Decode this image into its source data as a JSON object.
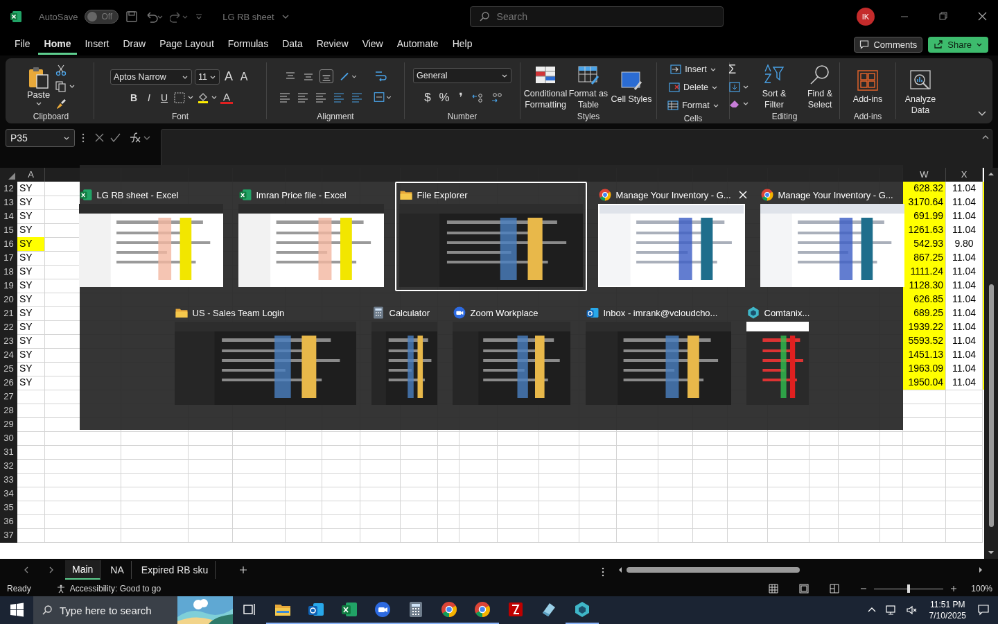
{
  "titlebar": {
    "autosave_label": "AutoSave",
    "autosave": {
      "label": "Off",
      "on": false
    },
    "doc_title": "LG RB sheet",
    "search_placeholder": "Search",
    "avatar": "IK"
  },
  "menu_tabs": [
    {
      "label": "File",
      "selected": false
    },
    {
      "label": "Home",
      "selected": true
    },
    {
      "label": "Insert",
      "selected": false
    },
    {
      "label": "Draw",
      "selected": false
    },
    {
      "label": "Page Layout",
      "selected": false
    },
    {
      "label": "Formulas",
      "selected": false
    },
    {
      "label": "Data",
      "selected": false
    },
    {
      "label": "Review",
      "selected": false
    },
    {
      "label": "View",
      "selected": false
    },
    {
      "label": "Automate",
      "selected": false
    },
    {
      "label": "Help",
      "selected": false
    }
  ],
  "comments_label": "Comments",
  "share_label": "Share",
  "ribbon": {
    "paste": "Paste",
    "font_name": "Aptos Narrow",
    "font_size": "11",
    "grow": "A",
    "shrink": "A",
    "bold": "B",
    "italic": "I",
    "underline": "U",
    "font_color": "A",
    "number_format": "General",
    "currency": "$",
    "percent": "%",
    "comma": "❜",
    "sum": "Σ",
    "big_buttons": [
      {
        "label": "Conditional Formatting",
        "kind": "conditional"
      },
      {
        "label": "Format as Table",
        "kind": "table"
      },
      {
        "label": "Cell Styles",
        "kind": "styles"
      }
    ],
    "cell_buttons": [
      {
        "label": "Insert",
        "kind": "insert"
      },
      {
        "label": "Delete",
        "kind": "delete"
      },
      {
        "label": "Format",
        "kind": "format"
      }
    ],
    "edit_buttons": [
      {
        "label": "Sort & Filter",
        "kind": "sort"
      },
      {
        "label": "Find & Select",
        "kind": "find"
      }
    ],
    "addins": "Add-ins",
    "analyze": "Analyze Data",
    "groups": [
      "Clipboard",
      "Font",
      "Alignment",
      "Number",
      "Styles",
      "Cells",
      "Editing",
      "Add-ins"
    ]
  },
  "name_box": "P35",
  "columns": [
    {
      "label": "A"
    },
    {
      "label": "W"
    },
    {
      "label": "X"
    }
  ],
  "rows": [
    {
      "number": "12",
      "cells": [
        "SY",
        "628.32",
        "11.04"
      ],
      "highlighted": false
    },
    {
      "number": "13",
      "cells": [
        "SY",
        "3170.64",
        "11.04"
      ],
      "highlighted": false
    },
    {
      "number": "14",
      "cells": [
        "SY",
        "691.99",
        "11.04"
      ],
      "highlighted": false
    },
    {
      "number": "15",
      "cells": [
        "SY",
        "1261.63",
        "11.04"
      ],
      "highlighted": false
    },
    {
      "number": "16",
      "cells": [
        "SY",
        "542.93",
        "9.80"
      ],
      "highlighted": true
    },
    {
      "number": "17",
      "cells": [
        "SY",
        "867.25",
        "11.04"
      ],
      "highlighted": false
    },
    {
      "number": "18",
      "cells": [
        "SY",
        "1111.24",
        "11.04"
      ],
      "highlighted": false
    },
    {
      "number": "19",
      "cells": [
        "SY",
        "1128.30",
        "11.04"
      ],
      "highlighted": false
    },
    {
      "number": "20",
      "cells": [
        "SY",
        "626.85",
        "11.04"
      ],
      "highlighted": false
    },
    {
      "number": "21",
      "cells": [
        "SY",
        "689.25",
        "11.04"
      ],
      "highlighted": false
    },
    {
      "number": "22",
      "cells": [
        "SY",
        "1939.22",
        "11.04"
      ],
      "highlighted": false
    },
    {
      "number": "23",
      "cells": [
        "SY",
        "5593.52",
        "11.04"
      ],
      "highlighted": false
    },
    {
      "number": "24",
      "cells": [
        "SY",
        "1451.13",
        "11.04"
      ],
      "highlighted": false
    },
    {
      "number": "25",
      "cells": [
        "SY",
        "1963.09",
        "11.04"
      ],
      "highlighted": false
    },
    {
      "number": "26",
      "cells": [
        "SY",
        "1950.04",
        "11.04"
      ],
      "highlighted": false
    },
    {
      "number": "27"
    },
    {
      "number": "28"
    },
    {
      "number": "29"
    },
    {
      "number": "30"
    },
    {
      "number": "31"
    },
    {
      "number": "32"
    },
    {
      "number": "33"
    },
    {
      "number": "34"
    },
    {
      "number": "35"
    },
    {
      "number": "36"
    },
    {
      "number": "37"
    }
  ],
  "sheet_tabs": [
    {
      "label": "Main",
      "selected": true
    },
    {
      "label": "NA",
      "selected": false
    },
    {
      "label": "Expired RB sku",
      "selected": false
    }
  ],
  "status": {
    "ready": "Ready",
    "accessibility": "Accessibility: Good to go",
    "zoom": "100%",
    "zoom_slider": {
      "level": 0.5
    }
  },
  "switcher": [
    {
      "title": "LG RB sheet - Excel",
      "kind": "excel",
      "selected": false,
      "hovered": false
    },
    {
      "title": "Imran Price file - Excel",
      "kind": "excel",
      "selected": false,
      "hovered": false
    },
    {
      "title": "File Explorer",
      "kind": "folder",
      "selected": true,
      "hovered": false
    },
    {
      "title": "Manage Your Inventory - G...",
      "kind": "chrome",
      "selected": false,
      "hovered": true
    },
    {
      "title": "Manage Your Inventory - G...",
      "kind": "chrome",
      "selected": false,
      "hovered": false
    },
    {
      "title": "US - Sales Team Login",
      "kind": "folder",
      "selected": false,
      "hovered": false
    },
    {
      "title": "Calculator",
      "kind": "calculator",
      "selected": false,
      "hovered": false
    },
    {
      "title": "Zoom Workplace",
      "kind": "zoom",
      "selected": false,
      "hovered": false
    },
    {
      "title": "Inbox - imrank@vcloudcho...",
      "kind": "outlook",
      "selected": false,
      "hovered": false
    },
    {
      "title": "Comtanix...",
      "kind": "comtanix",
      "selected": false,
      "hovered": false
    }
  ],
  "taskbar": {
    "search_placeholder": "Type here to search",
    "apps": [
      {
        "kind": "taskview",
        "running": false
      },
      {
        "kind": "folder",
        "running": true
      },
      {
        "kind": "outlook",
        "running": true
      },
      {
        "kind": "excel",
        "running": true
      },
      {
        "kind": "zoom",
        "running": true
      },
      {
        "kind": "calculator",
        "running": true
      },
      {
        "kind": "chrome",
        "running": true
      },
      {
        "kind": "chrome",
        "running": true
      },
      {
        "kind": "filezilla",
        "running": false
      },
      {
        "kind": "notes",
        "running": false
      },
      {
        "kind": "comtanix",
        "running": true
      }
    ],
    "time": "11:51 PM",
    "date": "7/10/2025"
  }
}
